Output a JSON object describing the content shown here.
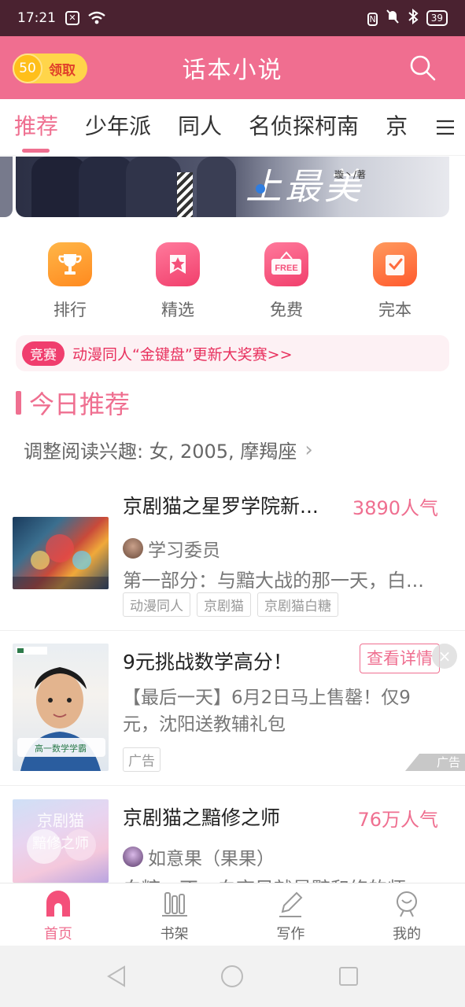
{
  "status_bar": {
    "time": "17:21",
    "battery": "39"
  },
  "header": {
    "title": "话本小说",
    "coin_value": "50",
    "claim_label": "领取"
  },
  "tabs": [
    {
      "label": "推荐",
      "active": true
    },
    {
      "label": "少年派"
    },
    {
      "label": "同人"
    },
    {
      "label": "名侦探柯南"
    },
    {
      "label": "京"
    }
  ],
  "banner": {
    "author": "璇丶/著"
  },
  "entries": [
    {
      "label": "排行",
      "icon": "trophy-icon",
      "color": "#ff9a2e"
    },
    {
      "label": "精选",
      "icon": "star-icon",
      "color": "#f4507a"
    },
    {
      "label": "免费",
      "icon": "free-tag-icon",
      "color": "#f4507a",
      "badge": "FREE"
    },
    {
      "label": "完本",
      "icon": "checkbox-icon",
      "color": "#ff6b3d"
    }
  ],
  "contest": {
    "tag": "竞赛",
    "text": "动漫同人“金键盘”更新大奖赛>>"
  },
  "section": {
    "title": "今日推荐",
    "interest": "调整阅读兴趣: 女, 2005, 摩羯座"
  },
  "books": [
    {
      "title": "京剧猫之星罗学院新...",
      "popularity": "3890人气",
      "author": "学习委员",
      "desc": "第一部分：与黯大战的那一天，白...",
      "tags": [
        "动漫同人",
        "京剧猫",
        "京剧猫白糖"
      ]
    },
    {
      "title": "京剧猫之黯修之师",
      "popularity": "76万人气",
      "author": "如意果（果果）",
      "desc": "白糖，不，白夜风就是黯和修的师"
    }
  ],
  "ad": {
    "title": "9元挑战数学高分！",
    "button": "查看详情",
    "close": "×",
    "desc": "【最后一天】6月2日马上售罄！仅9元，沈阳送教辅礼包",
    "tag": "广告",
    "mark": "广告",
    "image_caption": "高一数学学霸"
  },
  "bottom_nav": [
    {
      "label": "首页",
      "icon": "home-icon",
      "active": true
    },
    {
      "label": "书架",
      "icon": "bookshelf-icon"
    },
    {
      "label": "写作",
      "icon": "pen-icon"
    },
    {
      "label": "我的",
      "icon": "profile-icon"
    }
  ],
  "colors": {
    "brand": "#f06e90",
    "status_bar": "#4a2230"
  }
}
